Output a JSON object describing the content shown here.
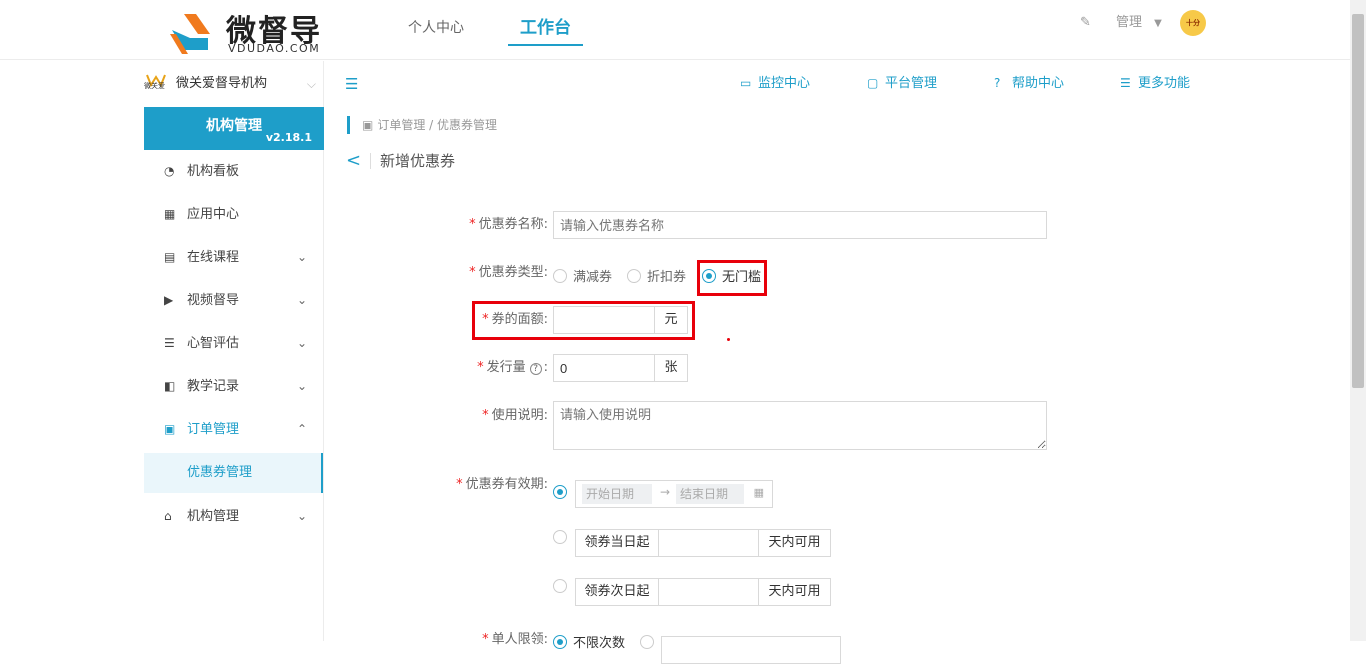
{
  "brand": {
    "name": "微督导",
    "sub": "VDUDAO.COM"
  },
  "topnav": {
    "personal": "个人中心",
    "workbench": "工作台"
  },
  "user": {
    "name": "管理",
    "avatar_text": "十分"
  },
  "sidebar": {
    "org_logo_text": "微关爱",
    "org_name": "微关爱督导机构",
    "mgmt_title": "机构管理",
    "version": "v2.18.1",
    "items": [
      {
        "label": "机构看板",
        "icon": "pie-chart-icon",
        "glyph": "◔"
      },
      {
        "label": "应用中心",
        "icon": "grid-icon",
        "glyph": "▦"
      },
      {
        "label": "在线课程",
        "icon": "book-icon",
        "glyph": "▤"
      },
      {
        "label": "视频督导",
        "icon": "video-icon",
        "glyph": "▶"
      },
      {
        "label": "心智评估",
        "icon": "list-icon",
        "glyph": "☰"
      },
      {
        "label": "教学记录",
        "icon": "camera-icon",
        "glyph": "◧"
      },
      {
        "label": "订单管理",
        "icon": "order-icon",
        "glyph": "▣"
      },
      {
        "label": "优惠券管理"
      },
      {
        "label": "机构管理",
        "icon": "bank-icon",
        "glyph": "⌂"
      }
    ]
  },
  "quicklinks": [
    {
      "label": "监控中心",
      "icon": "monitor-icon",
      "glyph": "▭"
    },
    {
      "label": "平台管理",
      "icon": "desktop-icon",
      "glyph": "▢"
    },
    {
      "label": "帮助中心",
      "icon": "help-icon",
      "glyph": "?"
    },
    {
      "label": "更多功能",
      "icon": "menu-icon",
      "glyph": "☰"
    }
  ],
  "breadcrumb": "订单管理 / 优惠券管理",
  "page_title": "新增优惠券",
  "form": {
    "name": {
      "label": "优惠券名称:",
      "placeholder": "请输入优惠券名称"
    },
    "type": {
      "label": "优惠券类型:",
      "options": [
        "满减券",
        "折扣券",
        "无门槛"
      ],
      "selected": "无门槛"
    },
    "amount": {
      "label": "券的面额:",
      "value": "",
      "unit": "元"
    },
    "quantity": {
      "label": "发行量",
      "value": "0",
      "unit": "张"
    },
    "desc": {
      "label": "使用说明:",
      "placeholder": "请输入使用说明"
    },
    "validity": {
      "label": "优惠券有效期:",
      "start": "开始日期",
      "end": "结束日期",
      "arrow": "→",
      "opt2_prefix": "领券当日起",
      "opt2_suffix": "天内可用",
      "opt3_prefix": "领券次日起",
      "opt3_suffix": "天内可用"
    },
    "limit": {
      "label": "单人限领:",
      "option": "不限次数"
    }
  },
  "colors": {
    "accent": "#1e9ec9",
    "highlight": "#e8000a"
  }
}
